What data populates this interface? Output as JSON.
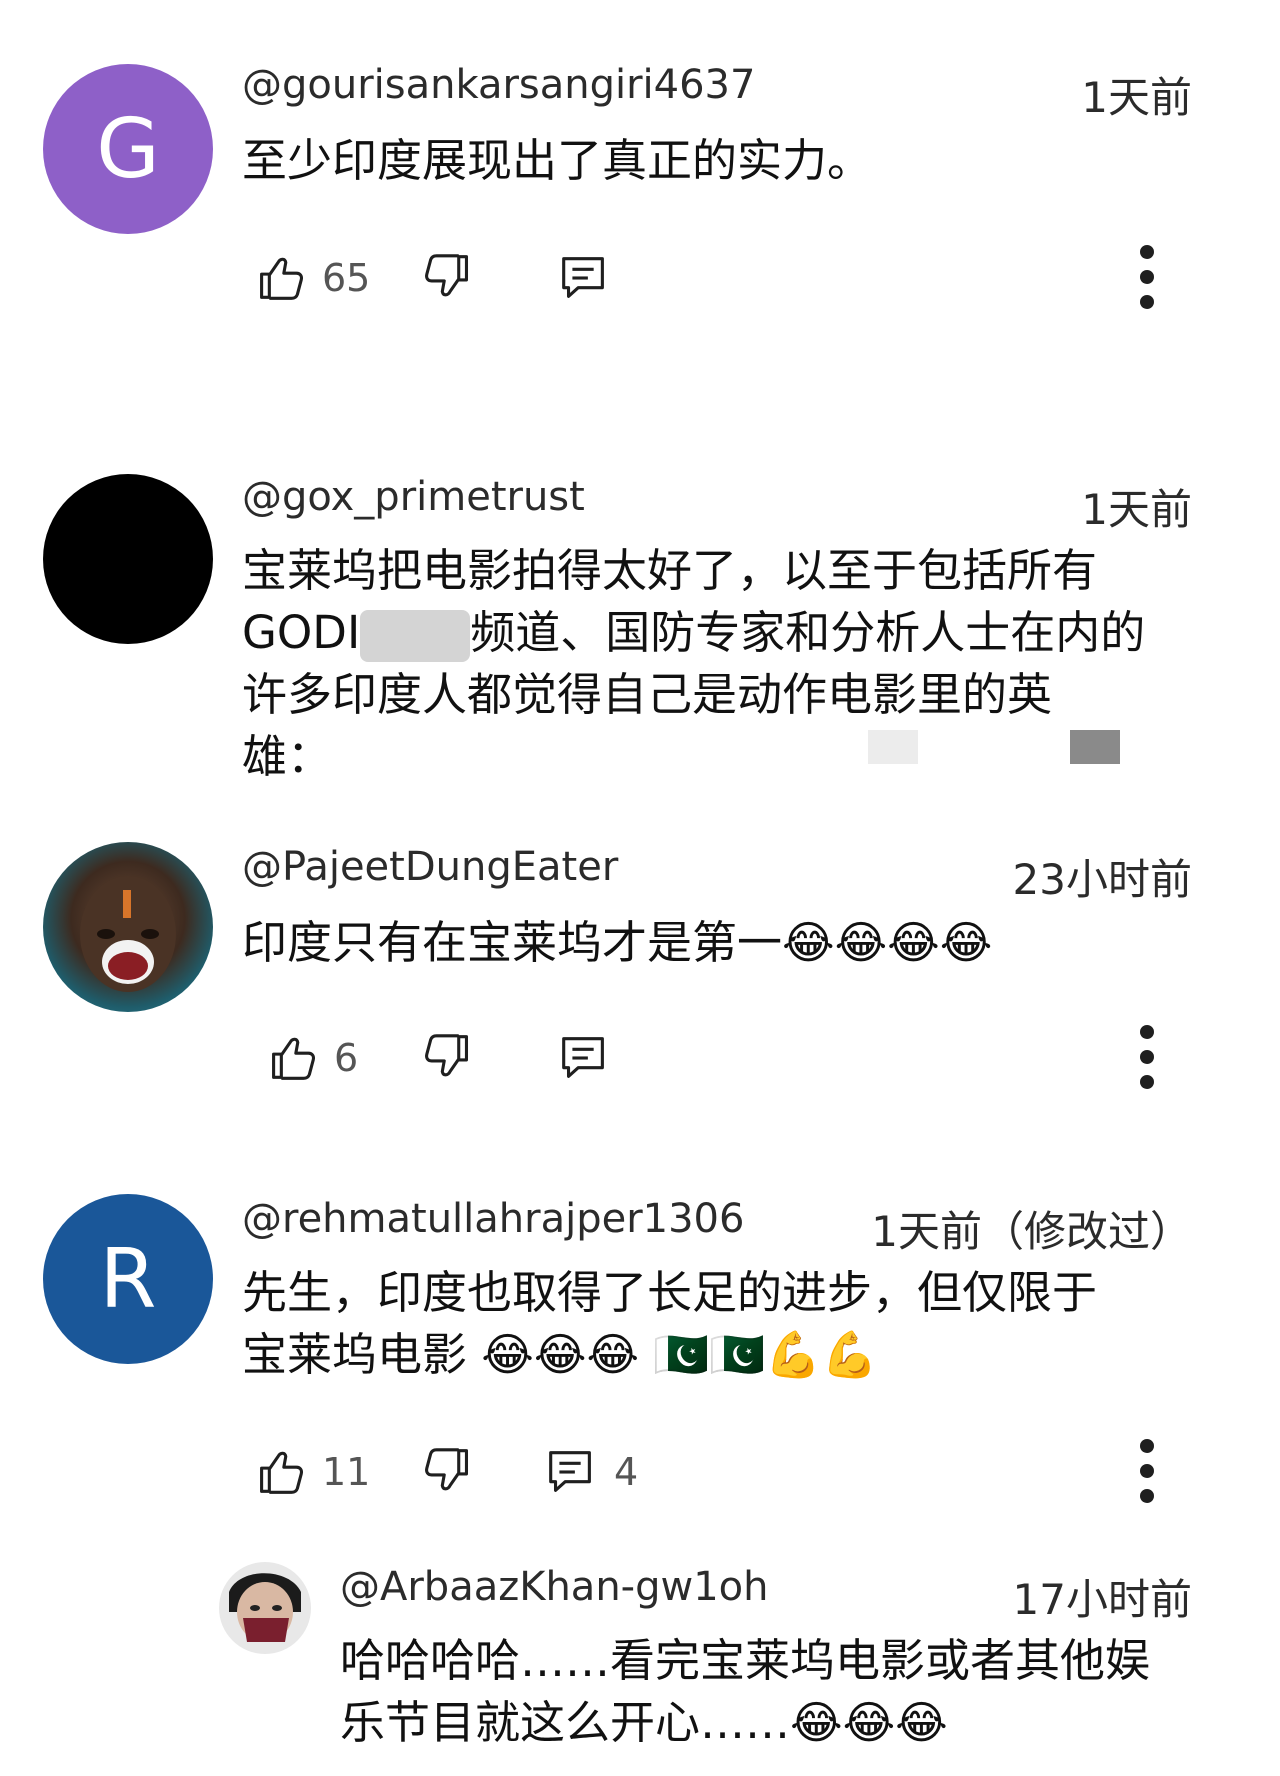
{
  "colors": {
    "avatar_g": "#8e60c8",
    "avatar_black": "#000000",
    "avatar_r": "#1a5799",
    "icon": "#1f1f1f",
    "muted": "#555555"
  },
  "comments": [
    {
      "avatar_letter": "G",
      "handle": "@gourisankarsangiri4637",
      "time": "1天前",
      "text": "至少印度展现出了真正的实力。",
      "likes": "65",
      "replies": ""
    },
    {
      "avatar_letter": "",
      "handle": "@gox_primetrust",
      "time": "1天前",
      "text_line1": "宝莱坞把电影拍得太好了，以至于包括所有",
      "text_line2_pre": "GODI",
      "text_line2_post": "频道、国防专家和分析人士在内的",
      "text_line3": "许多印度人都觉得自己是动作电影里的英",
      "text_line4": "雄："
    },
    {
      "avatar_letter": "",
      "handle": "@PajeetDungEater",
      "time": "23小时前",
      "text": "印度只有在宝莱坞才是第一😂😂😂😂",
      "likes": "6",
      "replies": ""
    },
    {
      "avatar_letter": "R",
      "handle": "@rehmatullahrajper1306",
      "time": "1天前（修改过）",
      "text_line1": "先生，印度也取得了长足的进步，但仅限于",
      "text_line2": "宝莱坞电影 😂😂😂 🇵🇰🇵🇰💪💪",
      "likes": "11",
      "replies": "4"
    },
    {
      "avatar_letter": "",
      "handle": "@ArbaazKhan-gw1oh",
      "time": "17小时前",
      "text_line1": "哈哈哈哈……看完宝莱坞电影或者其他娱",
      "text_line2": "乐节目就这么开心……😂😂😂"
    }
  ],
  "icons": {
    "like": "thumb-up-icon",
    "dislike": "thumb-down-icon",
    "reply": "comment-icon",
    "menu": "more-vert-icon"
  }
}
